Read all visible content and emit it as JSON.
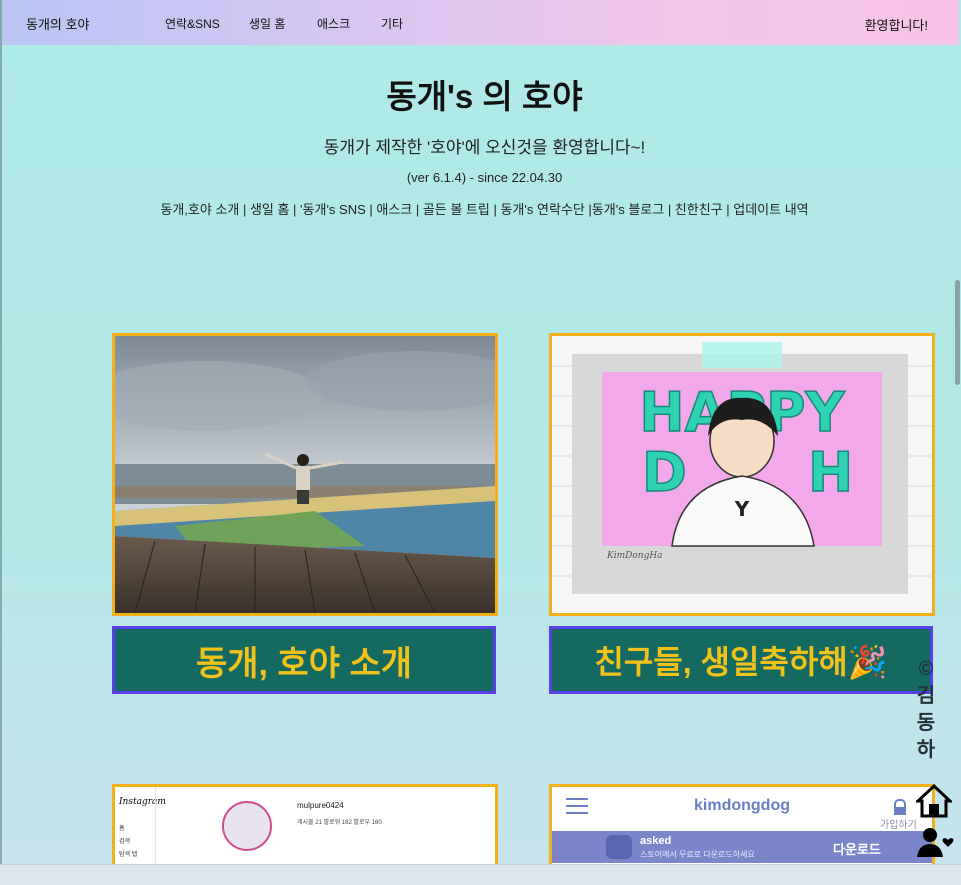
{
  "nav": {
    "brand": "동개의 호야",
    "items": [
      "연락&SNS",
      "생일 홈",
      "애스크",
      "기타"
    ],
    "welcome": "환영합니다!"
  },
  "header": {
    "title": "동개's 의 호야",
    "subtitle": "동개가 제작한 '호야'에 오신것을 환영합니다~!",
    "version": "(ver 6.1.4) - since 22.04.30",
    "links": "동개,호야 소개 | 생일 홈 | '동개's SNS | 애스크 | 골든 볼 트립 | 동개's 연락수단 |동개's 블로그 | 친한친구 | 업데이트 내역"
  },
  "cards": [
    {
      "button": "동개, 호야 소개"
    },
    {
      "button": "친구들, 생일축하해🎉",
      "image_text": "HAPPY D H",
      "signature": "KimDongHa"
    }
  ],
  "bottom_cards": {
    "instagram": {
      "logo": "Instagram",
      "username": "mulpure0424",
      "menu": [
        "홈",
        "검색",
        "탐색 탭"
      ],
      "stats": "게시물 21   팔로워 162   팔로우 160"
    },
    "asked": {
      "header": "kimdongdog",
      "signup": "가입하기",
      "banner_title": "asked",
      "banner_sub": "스토어에서 무료로 다운로드하세요",
      "download": "다운로드"
    }
  },
  "sidebar": {
    "copyright": "©김동하"
  },
  "icons": [
    "home-icon",
    "user-heart-icon",
    "lock-icon",
    "hamburger-icon"
  ],
  "colors": {
    "card_border": "#f2b01d",
    "button_bg": "#146a60",
    "button_border": "#5b3fe6",
    "button_text": "#f3c21a"
  }
}
